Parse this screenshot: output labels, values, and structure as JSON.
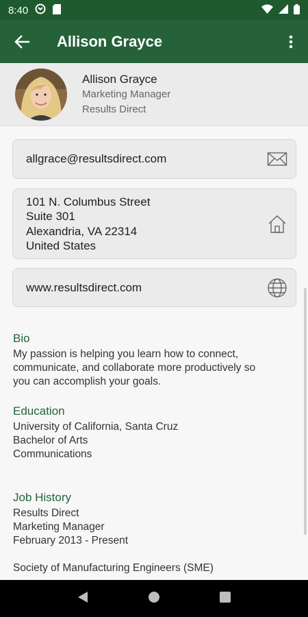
{
  "status_bar": {
    "time": "8:40"
  },
  "app_bar": {
    "title": "Allison Grayce"
  },
  "profile": {
    "name": "Allison Grayce",
    "title": "Marketing Manager",
    "company": "Results Direct"
  },
  "contact": {
    "email": "allgrace@resultsdirect.com",
    "address": [
      "101 N. Columbus Street",
      "Suite 301",
      "Alexandria, VA 22314",
      "United States"
    ],
    "website": "www.resultsdirect.com"
  },
  "bio": {
    "heading": "Bio",
    "lines": [
      "My passion is helping you learn how to connect,",
      "communicate, and collaborate more productively so",
      "you can accomplish your goals."
    ]
  },
  "education": {
    "heading": "Education",
    "lines": [
      "University of California, Santa Cruz",
      "Bachelor of Arts",
      "Communications"
    ]
  },
  "job_history": {
    "heading": "Job History",
    "jobs": [
      {
        "company": "Results Direct",
        "role": "Marketing Manager",
        "dates": "February 2013 - Present"
      },
      {
        "company": "Society of Manufacturing Engineers (SME)"
      }
    ]
  },
  "icons": {
    "status": [
      "sync-icon",
      "sim-card-icon",
      "wifi-icon",
      "signal-icon",
      "battery-icon"
    ],
    "email": "mail-icon",
    "address": "home-icon",
    "website": "globe-icon"
  }
}
